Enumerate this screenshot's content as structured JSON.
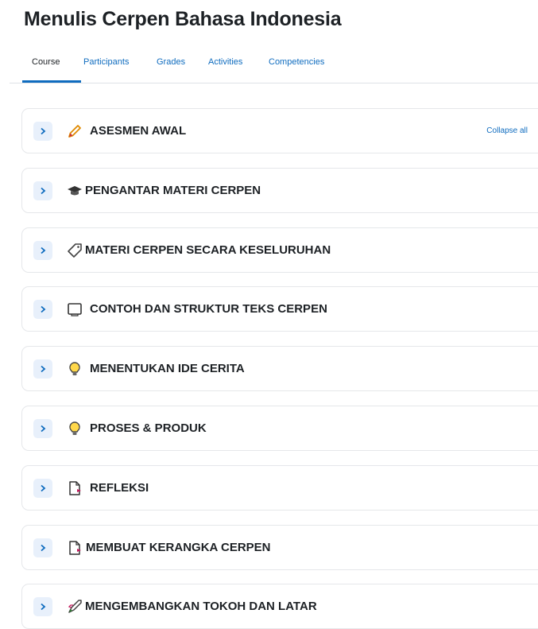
{
  "course": {
    "title": "Menulis Cerpen Bahasa Indonesia"
  },
  "tabs": [
    {
      "label": "Course"
    },
    {
      "label": "Participants"
    },
    {
      "label": "Grades"
    },
    {
      "label": "Activities"
    },
    {
      "label": "Competencies"
    }
  ],
  "collapse_all_label": "Collapse all",
  "sections": [
    {
      "title": "ASESMEN AWAL",
      "icon": "pencil-icon"
    },
    {
      "title": "PENGANTAR MATERI CERPEN",
      "icon": "graduation-cap-icon"
    },
    {
      "title": "MATERI CERPEN SECARA KESELURUHAN",
      "icon": "tag-icon"
    },
    {
      "title": "CONTOH DAN STRUKTUR TEKS CERPEN",
      "icon": "book-icon"
    },
    {
      "title": "MENENTUKAN IDE CERITA",
      "icon": "lightbulb-icon"
    },
    {
      "title": "PROSES & PRODUK",
      "icon": "lightbulb-icon"
    },
    {
      "title": "REFLEKSI",
      "icon": "document-icon"
    },
    {
      "title": "MEMBUAT KERANGKA CERPEN",
      "icon": "document-icon"
    },
    {
      "title": "MENGEMBANGKAN TOKOH DAN LATAR",
      "icon": "rocket-icon"
    }
  ]
}
